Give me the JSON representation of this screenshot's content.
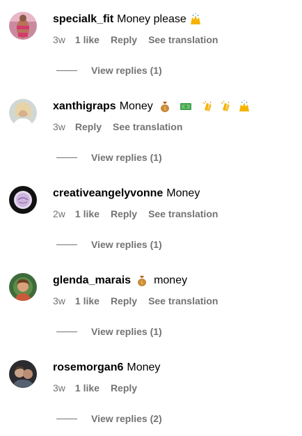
{
  "comments": [
    {
      "username": "specialk_fit",
      "text": "Money please",
      "emojis_after": [
        "raising-hands-emoji"
      ],
      "age": "3w",
      "likes": "1 like",
      "reply_label": "Reply",
      "translate_label": "See translation",
      "view_replies": "View replies (1)"
    },
    {
      "username": "xanthigraps",
      "text": "Money",
      "emojis_after": [
        "money-bag-emoji",
        "dollar-banknote-emoji",
        "clapping-hands-emoji",
        "clapping-hands-emoji",
        "raising-hands-emoji"
      ],
      "age": "3w",
      "reply_label": "Reply",
      "translate_label": "See translation",
      "view_replies": "View replies (1)"
    },
    {
      "username": "creativeangelyvonne",
      "text": "Money",
      "age": "2w",
      "likes": "1 like",
      "reply_label": "Reply",
      "translate_label": "See translation",
      "view_replies": "View replies (1)"
    },
    {
      "username": "glenda_marais",
      "text": "money",
      "emojis_before": [
        "money-bag-emoji"
      ],
      "age": "3w",
      "likes": "1 like",
      "reply_label": "Reply",
      "translate_label": "See translation",
      "view_replies": "View replies (1)"
    },
    {
      "username": "rosemorgan6",
      "text": "Money",
      "age": "3w",
      "likes": "1 like",
      "reply_label": "Reply",
      "view_replies": "View replies (2)"
    }
  ],
  "colors": {
    "secondary_text": "#737373",
    "primary_text": "#000000",
    "background": "#ffffff"
  }
}
